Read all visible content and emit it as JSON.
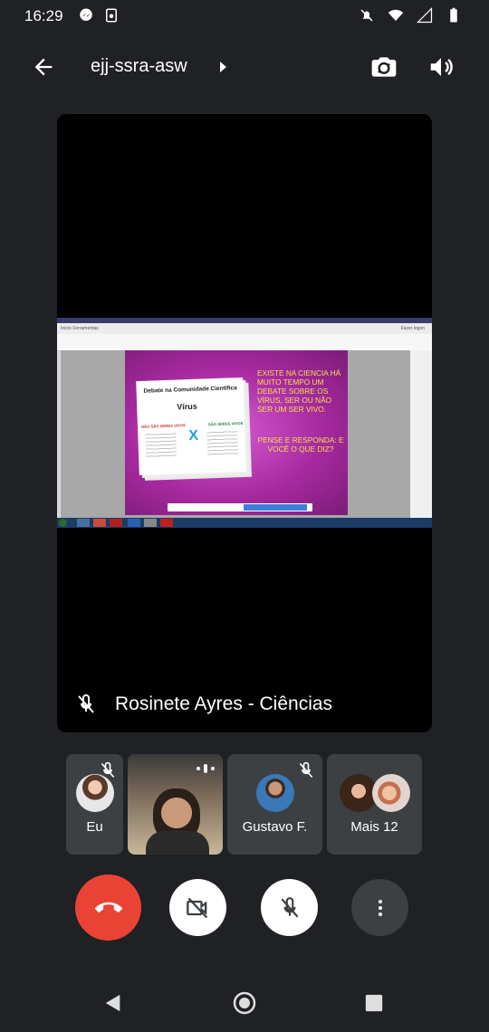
{
  "status_bar": {
    "time": "16:29",
    "icons": [
      "messenger-icon",
      "screen-cast-icon",
      "mute-bell-icon",
      "wifi-icon",
      "signal-icon",
      "battery-icon"
    ]
  },
  "header": {
    "meeting_code": "ejj-ssra-asw"
  },
  "main_tile": {
    "presenter_name": "Rosinete Ayres - Ciências",
    "presenter_muted": true,
    "shared_slide": {
      "tab_text": "Início    Ferramentas",
      "right_tab": "Fazer logon",
      "card_title": "Debate na Comunidade Científica",
      "card_subtitle": "Vírus",
      "card_left_header": "NÃO SÃO SERES VIVOS",
      "card_right_header": "SÃO SERES VIVOS",
      "card_center": "X",
      "question": "EXISTE NA CIENCIA HÁ MUITO TEMPO UM DEBATE SOBRE OS VÍRUS, SER OU NÃO SER UM SER VIVO.",
      "prompt": "PENSE E RESPONDA: E VOCÊ O QUE DIZ?"
    }
  },
  "participants": [
    {
      "label": "Eu",
      "muted": true
    },
    {
      "label": "",
      "speaking": true
    },
    {
      "label": "Gustavo F.",
      "muted": true
    },
    {
      "label": "Mais 12"
    }
  ],
  "controls": {
    "end_call": "end-call",
    "camera": "camera-off",
    "mic": "mic-off",
    "more": "more-options"
  },
  "colors": {
    "background": "#202124",
    "tile": "#3c4043",
    "end_call": "#ea4335",
    "slide_magenta": "#a72a9f",
    "slide_text": "#f4e04d"
  }
}
